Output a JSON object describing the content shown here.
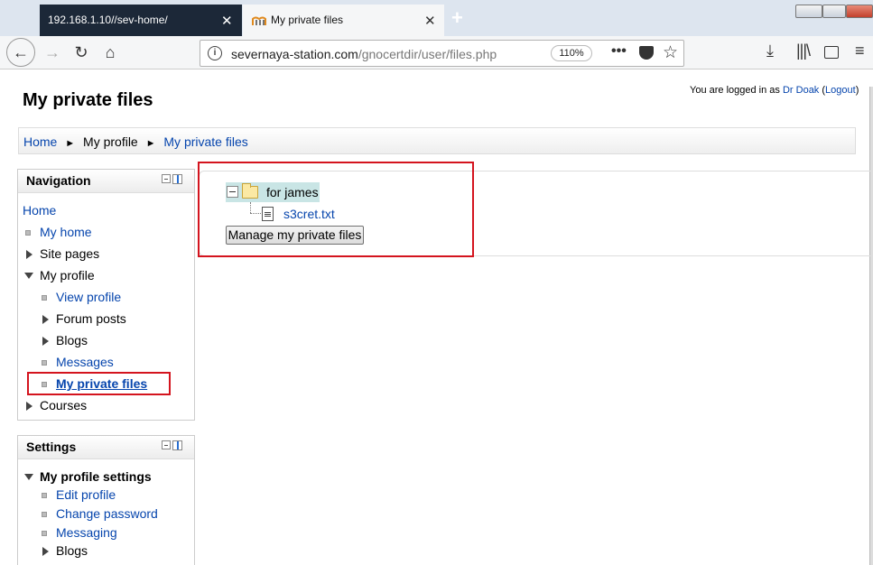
{
  "browser": {
    "tabs": [
      {
        "label": "192.168.1.10//sev-home/",
        "active": false
      },
      {
        "label": "My private files",
        "active": true
      }
    ],
    "url_host": "severnaya-station.com",
    "url_path": "/gnocertdir/user/files.php",
    "zoom": "110%",
    "icons": [
      "back-icon",
      "forward-icon",
      "reload-icon",
      "home-icon",
      "info-icon",
      "page-actions-icon",
      "pocket-icon",
      "bookmark-star-icon",
      "download-icon",
      "library-icon",
      "sidebar-icon",
      "menu-icon"
    ]
  },
  "header": {
    "page_title": "My private files",
    "login_prefix": "You are logged in as",
    "user_name": "Dr Doak",
    "logout_open": " (",
    "logout_label": "Logout",
    "logout_close": ")"
  },
  "breadcrumb": {
    "items": [
      "Home",
      "My profile",
      "My private files"
    ],
    "separator": "►"
  },
  "navigation": {
    "title": "Navigation",
    "home": "Home",
    "my_home": "My home",
    "site_pages": "Site pages",
    "my_profile": "My profile",
    "view_profile": "View profile",
    "forum_posts": "Forum posts",
    "blogs": "Blogs",
    "messages": "Messages",
    "my_private_files": "My private files",
    "courses": "Courses"
  },
  "settings": {
    "title": "Settings",
    "my_profile_settings": "My profile settings",
    "edit_profile": "Edit profile",
    "change_password": "Change password",
    "messaging": "Messaging",
    "blogs": "Blogs"
  },
  "files": {
    "folder_name": "for james",
    "file_name": "s3cret.txt",
    "manage_button": "Manage my private files"
  },
  "colors": {
    "link": "#0645ad",
    "highlight_box": "#d4141e",
    "folder_row_bg": "#c9e5e5"
  }
}
